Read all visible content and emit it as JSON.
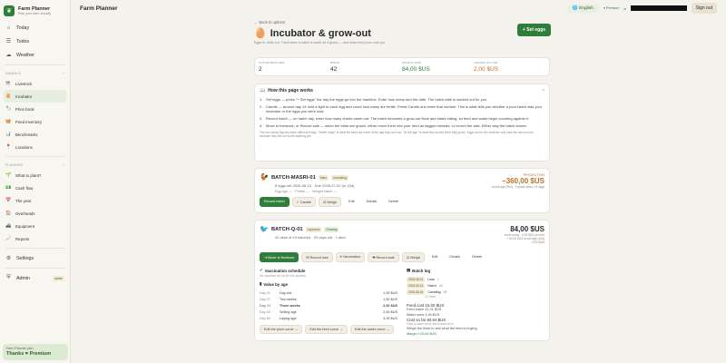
{
  "app": {
    "name": "Farm Planner",
    "tagline": "Plan your farm visually"
  },
  "nav": {
    "today": "Today",
    "todos": "Todos",
    "weather": "Weather",
    "animals_section": "ANIMALS",
    "animals_collapse": "^",
    "animals": [
      {
        "label": "Livestock",
        "icon": "ram-icon"
      },
      {
        "label": "Incubator",
        "icon": "egg-icon"
      },
      {
        "label": "Price book",
        "icon": "tag-icon"
      },
      {
        "label": "Feed inventory",
        "icon": "bag-icon"
      },
      {
        "label": "Benchmarks",
        "icon": "chart-icon"
      },
      {
        "label": "Locations",
        "icon": "pin-icon"
      }
    ],
    "planning_section": "PLANNING",
    "planning_collapse": "^",
    "planning": [
      {
        "label": "What to plant?",
        "icon": "sprout-icon"
      },
      {
        "label": "Cash flow",
        "icon": "cash-icon"
      },
      {
        "label": "The year",
        "icon": "calendar-icon"
      },
      {
        "label": "Overheads",
        "icon": "building-icon"
      },
      {
        "label": "Equipment",
        "icon": "tractor-icon"
      },
      {
        "label": "Reports",
        "icon": "report-icon"
      }
    ],
    "settings": "Settings",
    "admin": "Admin",
    "admin_badge": "admin"
  },
  "plan": {
    "label": "Farm Planner plan",
    "value": "Thanks ♥ Premium"
  },
  "topbar": {
    "title": "Farm Planner",
    "language": "English",
    "premium": "● Premium",
    "email_prefix": "a",
    "signout": "Sign out"
  },
  "page": {
    "back": "← Back to options",
    "title": "Incubator & grow-out",
    "subtitle": "Eggs in, birds out. Track when a batch is worth as it grows — and what every loss cost you.",
    "set_eggs": "+ Set eggs"
  },
  "stats": [
    {
      "label": "ACTIVE BATCHES",
      "value": "2"
    },
    {
      "label": "BIRDS",
      "value": "42"
    },
    {
      "label": "WORTH NOW",
      "value": "84,00 $US"
    },
    {
      "label": "LOSSES SO FAR",
      "value": "2,00 $US"
    }
  ],
  "how": {
    "title": "How this page works",
    "close": "×",
    "steps": [
      {
        "n": "1.",
        "text": "Set eggs — press \"+ Set eggs\" the day the eggs go into the machine. Enter how many and the date. The hatch date is worked out for you."
      },
      {
        "n": "2.",
        "text": "Candle — around day 14 hold a light to each egg and count how many are fertile. Press Candle and enter that number. This is what tells you whether a poor hatch was your incubator or the eggs you were sold."
      },
      {
        "n": "3.",
        "text": "Record hatch — on hatch day, enter how many chicks came out. The batch becomes a grow-out flock and starts eating, so feed and water begin counting against it."
      },
      {
        "n": "4.",
        "text": "Move to livestock, or Record sale — when the birds are grown, either move them into your herd as tagged animals, or record the sale. Either way the batch closes."
      }
    ],
    "fine": "The two money figures mean different things. \"Worth today\" is what the birds are worth at the age they are now. \"At sell age\" is what they should fetch fully grown. Eggs cost in the machine only have the second one, because they are not worth anything yet."
  },
  "batch1": {
    "name": "BATCH-MASRI-01",
    "tag1": "Masr",
    "tag2": "Incubating",
    "info": "8 eggs set 2026-06-13 · Due 2026-07-02 (in 13d)",
    "sub": "Egg age — · Fertile — · Weight hatch —",
    "proj_label": "PROJECTION",
    "proj_value": "−360,00 $US",
    "proj_sub": "at sell age (90d) · 4 grown birds × 8 eggs",
    "actions": [
      "Record hatch",
      "✓ Candle",
      "⚖ Weigh",
      "Edit",
      "Details",
      "Delete"
    ]
  },
  "batch2": {
    "name": "BATCH-Q-01",
    "tag1": "Japanese",
    "tag2": "Growing",
    "info": "42 alive of 43 hatched · 20 days old · 1 died",
    "value": "84,00 $US",
    "sub1": "worth today · 2,00 $US per bird",
    "sub2": "+ 60,00 $US at sell age (42d)",
    "loss": "−2,00 $US",
    "actions": [
      "⇥ Move to livestock",
      "✉ Record loss",
      "⌖ Vaccination",
      "✚ Record sale",
      "⚖ Weigh",
      "Edit",
      "Details",
      "Delete"
    ],
    "vacc_title": "Vaccination schedule",
    "vacc_sub": "No vaccines set up for this species.",
    "value_title": "Value by age",
    "value_rows": [
      [
        "Day 01",
        "Day-old",
        "1,00 $US"
      ],
      [
        "Day 07",
        "Two weeks",
        "1,50 $US"
      ],
      [
        "Day 21",
        "Three weeks",
        "2,00 $US"
      ],
      [
        "Day 30",
        "Selling age",
        "2,50 $US"
      ],
      [
        "Day 60",
        "Laying age",
        "3,00 $US"
      ]
    ],
    "edits": [
      "Edit the price curve →",
      "Edit the feed curve →",
      "Edit the water curve →"
    ],
    "log_title": "Batch log",
    "log": [
      {
        "date": "2026-06-01",
        "event": "Loss",
        "value": "1"
      },
      {
        "date": "2026-06-14",
        "event": "Hatch",
        "value": "43"
      },
      {
        "date": "2026-06-24",
        "event": "Candling",
        "value": "45"
      }
    ],
    "log_more": "10 more",
    "totals": {
      "feed": "Feed cost 15,00 $US",
      "feed_eaten": "Feed eaten 41,31 $US",
      "water": "Water used 4,45 $US",
      "cost": "Cost so far 60,94 $US",
      "cost_note": "Feed & water at the last known price",
      "grown": "Weigh the birds to see what the feed is buying",
      "margin": "Margin +25,04 $US"
    }
  }
}
